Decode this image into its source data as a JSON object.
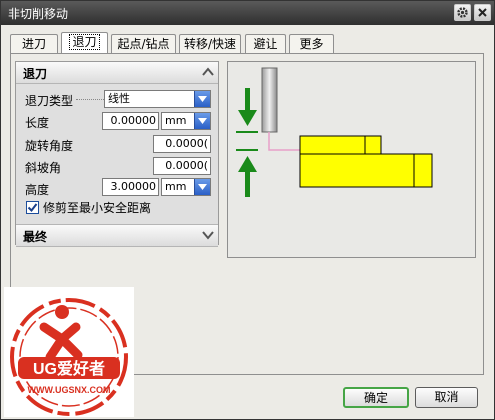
{
  "window": {
    "title": "非切削移动"
  },
  "tabs": [
    {
      "label": "进刀",
      "active": false
    },
    {
      "label": "退刀",
      "active": true
    },
    {
      "label": "起点/钻点",
      "active": false
    },
    {
      "label": "转移/快速",
      "active": false
    },
    {
      "label": "避让",
      "active": false
    },
    {
      "label": "更多",
      "active": false
    }
  ],
  "retract": {
    "section_title": "退刀",
    "type_label": "退刀类型",
    "type_value": "线性",
    "length_label": "长度",
    "length_value": "0.00000",
    "length_unit": "mm",
    "rotation_label": "旋转角度",
    "rotation_value": "0.0000(",
    "slope_label": "斜坡角",
    "slope_value": "0.0000(",
    "height_label": "高度",
    "height_value": "3.00000",
    "height_unit": "mm",
    "trim_label": "修剪至最小安全距离",
    "trim_checked": true
  },
  "final": {
    "section_title": "最终"
  },
  "buttons": {
    "ok": "确定",
    "cancel": "取消"
  },
  "logo": {
    "text": "UG爱好者",
    "url": "WWW.UGSNX.COM"
  },
  "colors": {
    "accent_green": "#1a8a1a",
    "part_yellow": "#ffff00",
    "tool_pink": "#e8a0c8"
  }
}
